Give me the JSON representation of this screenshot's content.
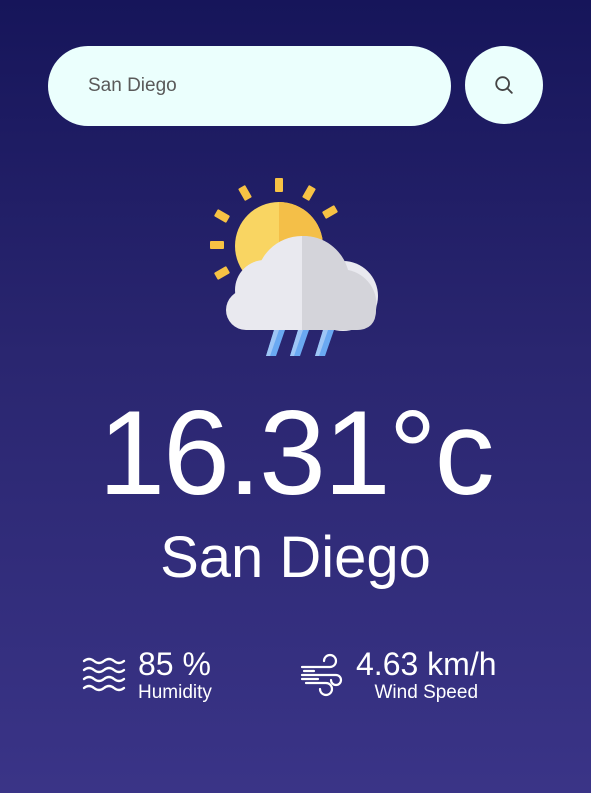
{
  "search": {
    "value": "San Diego",
    "placeholder": "San Diego"
  },
  "weather": {
    "icon": "sun-cloud-rain-icon",
    "temperature": "16.31°c",
    "city": "San Diego"
  },
  "stats": {
    "humidity": {
      "value": "85 %",
      "label": "Humidity",
      "icon": "waves-icon"
    },
    "wind": {
      "value": "4.63 km/h",
      "label": "Wind Speed",
      "icon": "wind-icon"
    }
  },
  "colors": {
    "background_top": "#16155a",
    "background_bottom": "#3a3487",
    "input_bg": "#ebfffd",
    "sun": "#f7c244",
    "cloud": "#e9e9ef",
    "rain": "#6aa9f2"
  }
}
